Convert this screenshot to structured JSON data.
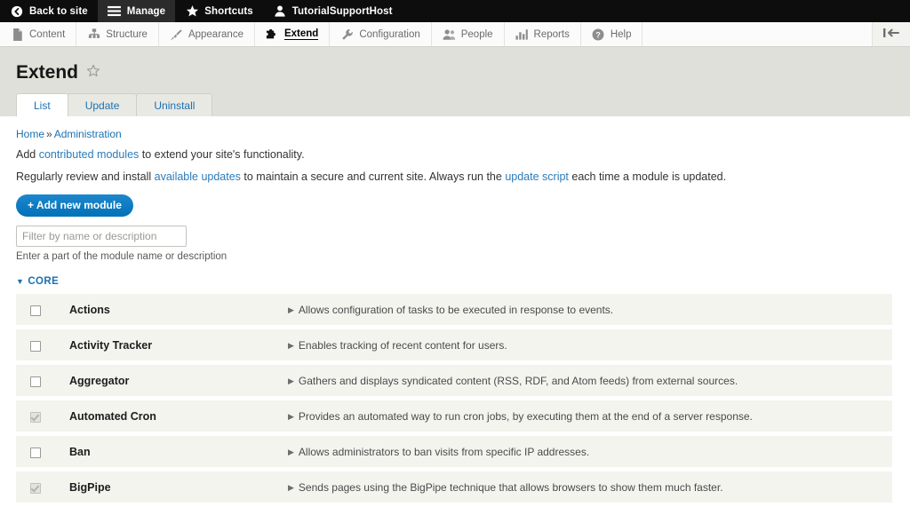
{
  "admin_bar": {
    "items": [
      {
        "label": "Back to site",
        "icon": "back-arrow-icon",
        "active": false
      },
      {
        "label": "Manage",
        "icon": "hamburger-icon",
        "active": true
      },
      {
        "label": "Shortcuts",
        "icon": "star-icon",
        "active": false
      },
      {
        "label": "TutorialSupportHost",
        "icon": "user-icon",
        "active": false
      }
    ]
  },
  "toolbar": {
    "items": [
      {
        "label": "Content",
        "icon": "file-icon",
        "active": false
      },
      {
        "label": "Structure",
        "icon": "sitemap-icon",
        "active": false
      },
      {
        "label": "Appearance",
        "icon": "paintbrush-icon",
        "active": false
      },
      {
        "label": "Extend",
        "icon": "puzzle-piece-icon",
        "active": true
      },
      {
        "label": "Configuration",
        "icon": "wrench-icon",
        "active": false
      },
      {
        "label": "People",
        "icon": "people-icon",
        "active": false
      },
      {
        "label": "Reports",
        "icon": "bar-chart-icon",
        "active": false
      },
      {
        "label": "Help",
        "icon": "question-mark-icon",
        "active": false
      }
    ],
    "orientation_toggle_icon": "toolbar-orientation-icon"
  },
  "page": {
    "title": "Extend",
    "star_icon": "shortcut-star-icon",
    "tabs": [
      {
        "label": "List",
        "active": true
      },
      {
        "label": "Update",
        "active": false
      },
      {
        "label": "Uninstall",
        "active": false
      }
    ]
  },
  "breadcrumb": {
    "home": "Home",
    "separator": "»",
    "current": "Administration"
  },
  "intro": {
    "line1_pre": "Add ",
    "line1_link": "contributed modules",
    "line1_post": " to extend your site's functionality.",
    "line2_pre": "Regularly review and install ",
    "line2_link1": "available updates",
    "line2_mid": " to maintain a secure and current site. Always run the ",
    "line2_link2": "update script",
    "line2_post": " each time a module is updated."
  },
  "actions": {
    "add_module_label": "+ Add new module"
  },
  "filter": {
    "value": "",
    "placeholder": "Filter by name or description",
    "description": "Enter a part of the module name or description"
  },
  "groups": [
    {
      "caret": "▼",
      "name": "CORE",
      "modules": [
        {
          "name": "Actions",
          "description": "Allows configuration of tasks to be executed in response to events.",
          "installed": false
        },
        {
          "name": "Activity Tracker",
          "description": "Enables tracking of recent content for users.",
          "installed": false
        },
        {
          "name": "Aggregator",
          "description": "Gathers and displays syndicated content (RSS, RDF, and Atom feeds) from external sources.",
          "installed": false
        },
        {
          "name": "Automated Cron",
          "description": "Provides an automated way to run cron jobs, by executing them at the end of a server response.",
          "installed": true
        },
        {
          "name": "Ban",
          "description": "Allows administrators to ban visits from specific IP addresses.",
          "installed": false
        },
        {
          "name": "BigPipe",
          "description": "Sends pages using the BigPipe technique that allows browsers to show them much faster.",
          "installed": true
        }
      ]
    }
  ],
  "colors": {
    "admin_bar_bg": "#0d0d0d",
    "header_band": "#e0e0db",
    "link_blue": "#1a71b0",
    "button_blue": "#0071b8",
    "row_bg": "#f4f4ef"
  }
}
